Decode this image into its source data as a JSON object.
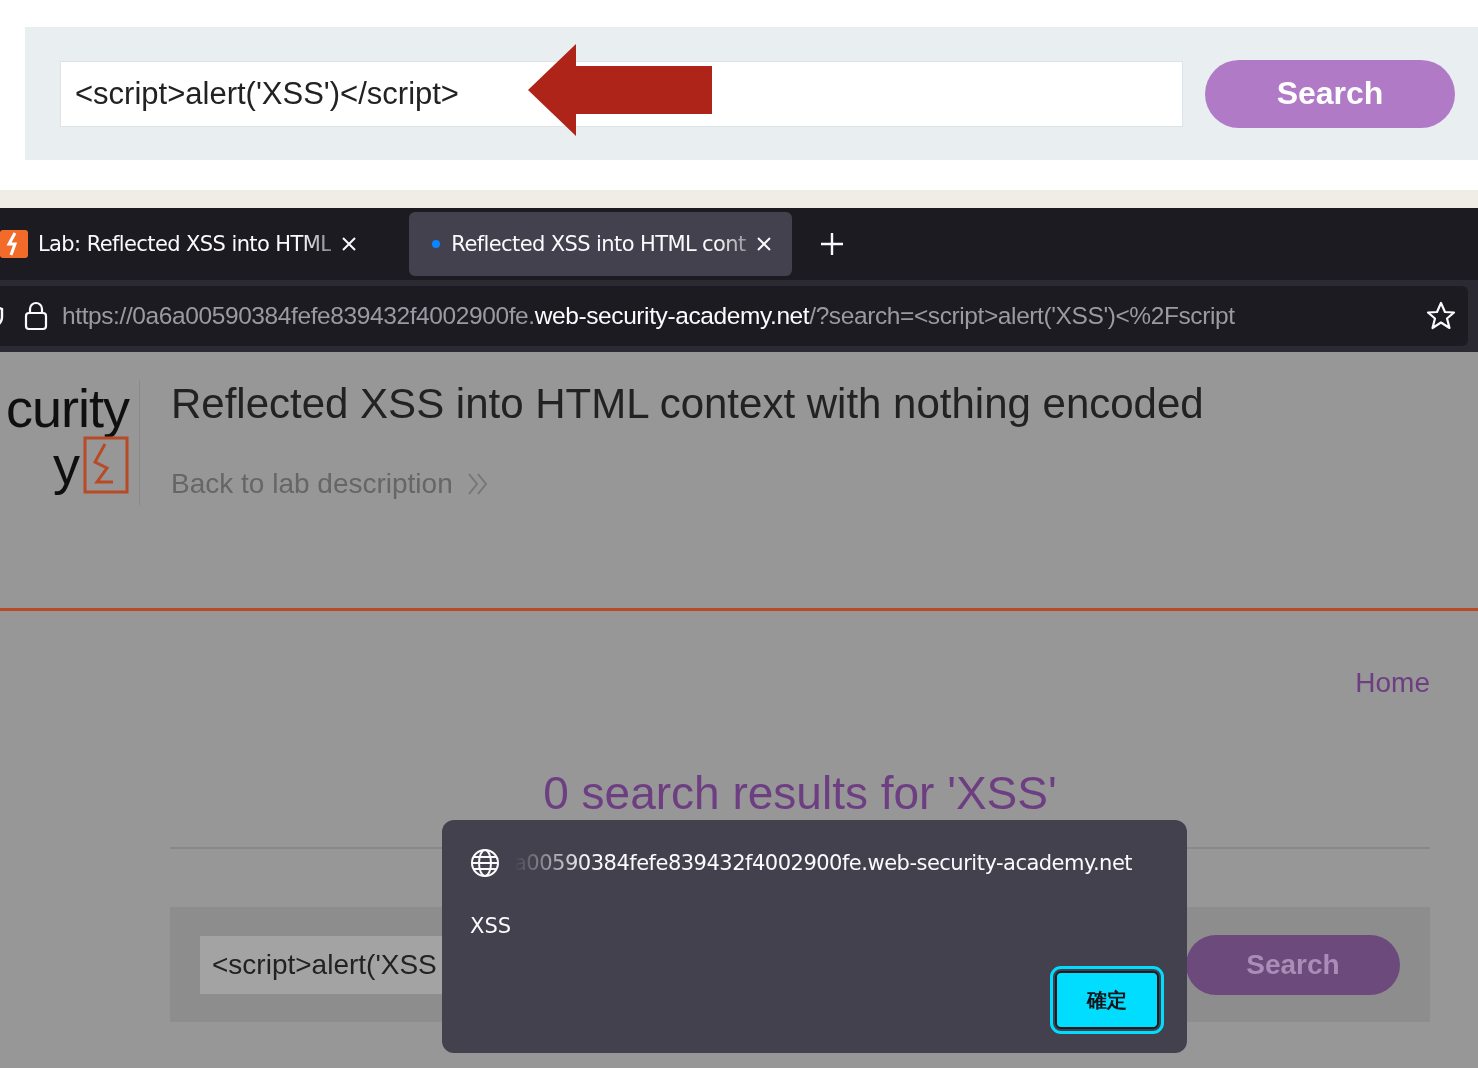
{
  "annotation": {
    "search_field": {
      "value": "<script>alert('XSS')</script>"
    },
    "search_button": "Search"
  },
  "browser": {
    "tabs": [
      {
        "title": "Lab: Reflected XSS into HTML",
        "kind": "favicon",
        "selected": false
      },
      {
        "title": "Reflected XSS into HTML cont",
        "kind": "dot",
        "selected": true
      }
    ],
    "address_bar": {
      "url_prefix": "https://0a6a00590384fefe839432f4002900fe.",
      "url_domain": "web-security-academy.net",
      "url_path": "/?search=<script>alert('XSS')<%2Fscript"
    }
  },
  "page": {
    "logo": [
      "curity",
      "y"
    ],
    "title": "Reflected XSS into HTML context with nothing encoded",
    "back_link": "Back to lab description",
    "nav": [
      "Home"
    ],
    "results_heading": "0 search results for 'XSS'",
    "search": {
      "value": "<script>alert('XSS",
      "button": "Search"
    }
  },
  "dialog": {
    "origin": "a00590384fefe839432f4002900fe.web-security-academy.net",
    "message": "XSS",
    "button": "確定"
  }
}
